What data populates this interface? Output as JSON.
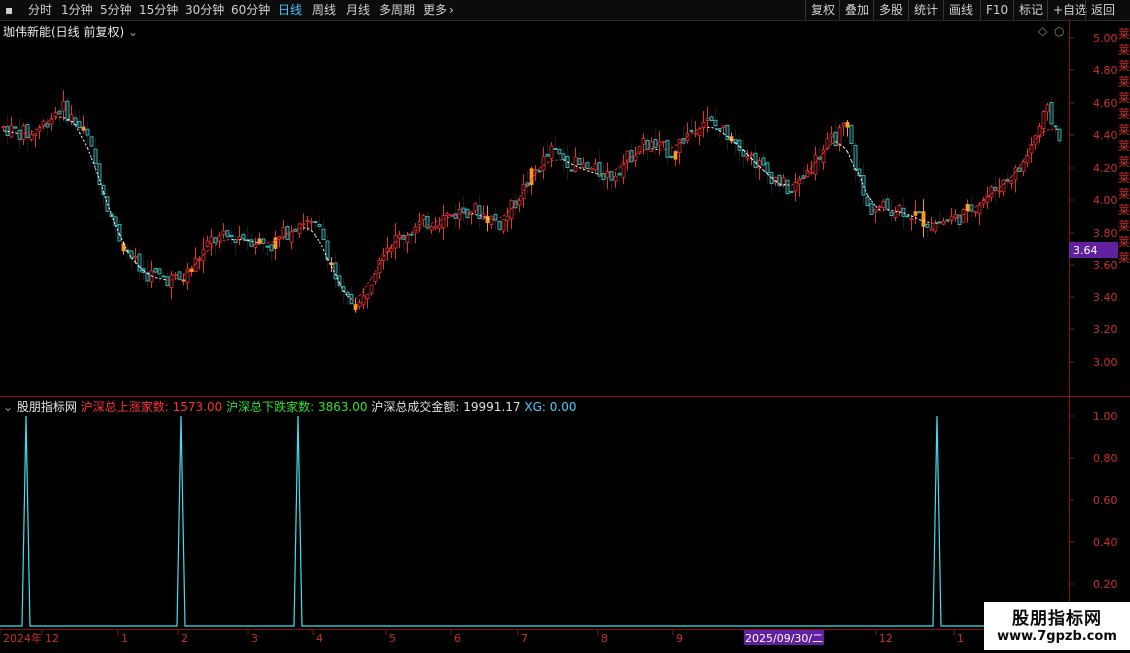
{
  "toolbar": {
    "periods": [
      "分时",
      "1分钟",
      "5分钟",
      "15分钟",
      "30分钟",
      "60分钟",
      "日线",
      "周线",
      "月线",
      "多周期",
      "更多"
    ],
    "active_period": "日线",
    "right_buttons": [
      "复权",
      "叠加",
      "多股",
      "统计",
      "画线",
      "F10",
      "标记",
      "+自选",
      "返回"
    ]
  },
  "main": {
    "title": "珈伟新能(日线 前复权)",
    "y_ticks": [
      "5.00",
      "4.80",
      "4.60",
      "4.40",
      "4.20",
      "4.00",
      "3.80",
      "3.60",
      "3.40",
      "3.20",
      "3.00"
    ],
    "current_price": "3.64",
    "colors": {
      "up": "#e03030",
      "down": "#30d8d8",
      "ma_up": "#ff3030",
      "ma_down": "#ffffff",
      "special": "#ff9a20",
      "price_tag": "#6020a0"
    }
  },
  "sub": {
    "name": "股朋指标网",
    "items": [
      {
        "label": "沪深总上涨家数:",
        "value": "1573.00",
        "color": "#ff3030"
      },
      {
        "label": "沪深总下跌家数:",
        "value": "3863.00",
        "color": "#30e030"
      },
      {
        "label": "沪深总成交金额:",
        "value": "19991.17",
        "color": "#e0e0e0"
      },
      {
        "label": "XG:",
        "value": "0.00",
        "color": "#40d0ff"
      }
    ],
    "y_ticks": [
      "1.00",
      "0.80",
      "0.60",
      "0.40",
      "0.20"
    ],
    "line_color": "#40e0f0"
  },
  "dates": {
    "labels": [
      "2024年",
      "12",
      "1",
      "2",
      "3",
      "4",
      "5",
      "6",
      "7",
      "8",
      "9",
      "2025/09/30/二",
      "12",
      "1"
    ]
  },
  "logo": {
    "line1": "股朋指标网",
    "line2": "www.7gpzb.com"
  },
  "side_text": "莱莱莱莱莱莱莱莱莱莱莱莱莱莱莱"
}
